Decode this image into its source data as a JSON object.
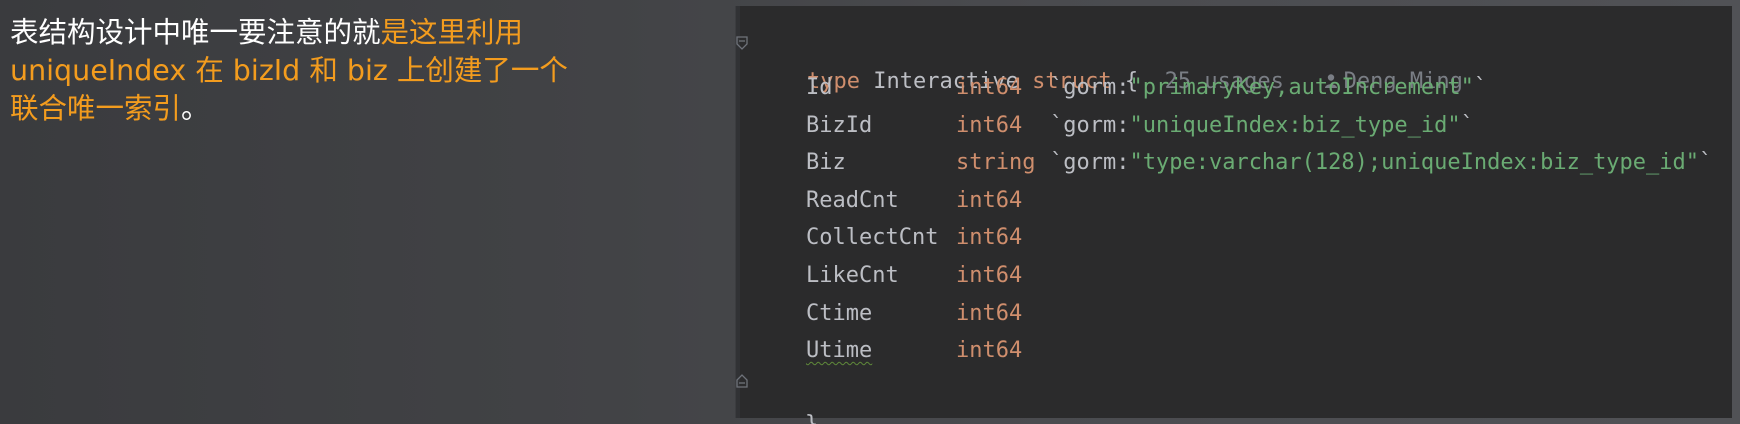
{
  "note": {
    "plain": "表结构设计中唯一要注意的就",
    "highlight_line1": "是这里利用",
    "highlight_line2": "uniqueIndex 在 bizId 和 biz 上创建了一个",
    "highlight_line3": "联合唯一索引",
    "tail": "。",
    "highlight_color": "#f39c1e"
  },
  "editor": {
    "header": {
      "kw_type": "type",
      "name": "Interactive",
      "kw_struct": "struct",
      "brace_open": "{",
      "usages": "25 usages",
      "author": "Deng Ming",
      "author_icon": "user-icon"
    },
    "fields": [
      {
        "name": "Id",
        "type": "int64",
        "tag_open": "`gorm:",
        "tag_value": "\"primaryKey,autoIncrement\"",
        "tag_close": "`"
      },
      {
        "name": "BizId",
        "type": "int64",
        "tag_open": "`gorm:",
        "tag_value": "\"uniqueIndex:biz_type_id\"",
        "tag_close": "`"
      },
      {
        "name": "Biz",
        "type": "string",
        "tag_open": "`gorm:",
        "tag_value": "\"type:varchar(128);uniqueIndex:biz_type_id\"",
        "tag_close": "`"
      },
      {
        "name": "ReadCnt",
        "type": "int64",
        "tag_open": "",
        "tag_value": "",
        "tag_close": ""
      },
      {
        "name": "CollectCnt",
        "type": "int64",
        "tag_open": "",
        "tag_value": "",
        "tag_close": ""
      },
      {
        "name": "LikeCnt",
        "type": "int64",
        "tag_open": "",
        "tag_value": "",
        "tag_close": ""
      },
      {
        "name": "Ctime",
        "type": "int64",
        "tag_open": "",
        "tag_value": "",
        "tag_close": ""
      },
      {
        "name": "Utime",
        "type": "int64",
        "tag_open": "",
        "tag_value": "",
        "tag_close": ""
      }
    ],
    "brace_close": "}",
    "colors": {
      "keyword": "#cf8e6d",
      "string": "#6aab73",
      "hint": "#7a7e85",
      "text": "#bcbec4",
      "background": "#2b2b2c"
    }
  }
}
